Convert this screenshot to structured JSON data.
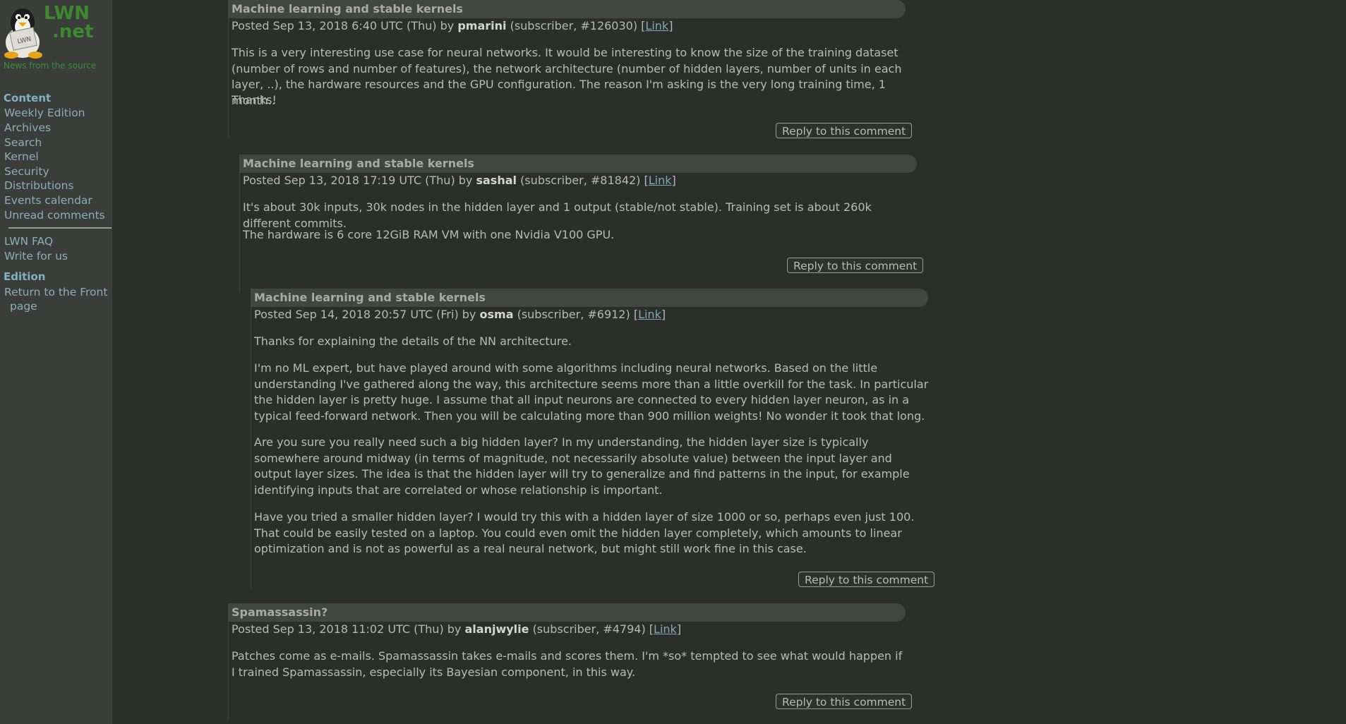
{
  "site": {
    "logo_line1": "LWN",
    "logo_line2": ".net",
    "tagline": "News from the source",
    "penguin_badge": "LWN"
  },
  "sidebar": {
    "content_heading": "Content",
    "content_items": [
      "Weekly Edition",
      "Archives",
      "Search",
      "Kernel",
      "Security",
      "Distributions",
      "Events calendar",
      "Unread comments"
    ],
    "extra_items": [
      "LWN FAQ",
      "Write for us"
    ],
    "edition_heading": "Edition",
    "edition_item_line1": "Return to the Front",
    "edition_item_line2": "page"
  },
  "comments": [
    {
      "title": "Machine learning and stable kernels",
      "posted_prefix": "Posted Sep 13, 2018 6:40 UTC (Thu) by",
      "author": "pmarini",
      "subscriber": "(subscriber, #126030)",
      "link_label": "Link",
      "paragraphs": [
        "This is a very interesting use case for neural networks. It would be interesting to know the size of the training dataset (number of rows and number of features), the network architecture (number of hidden layers, number of units in each layer, ..), the hardware resources and the GPU configuration. The reason I'm asking is the very long training time, 1 month..",
        "Thanks!"
      ],
      "reply_label": "Reply to this comment"
    },
    {
      "title": "Machine learning and stable kernels",
      "posted_prefix": "Posted Sep 13, 2018 17:19 UTC (Thu) by",
      "author": "sashal",
      "subscriber": "(subscriber, #81842)",
      "link_label": "Link",
      "paragraphs": [
        "It's about 30k inputs, 30k nodes in the hidden layer and 1 output (stable/not stable). Training set is about 260k different commits.",
        "The hardware is 6 core 12GiB RAM VM with one Nvidia V100 GPU."
      ],
      "reply_label": "Reply to this comment"
    },
    {
      "title": "Machine learning and stable kernels",
      "posted_prefix": "Posted Sep 14, 2018 20:57 UTC (Fri) by",
      "author": "osma",
      "subscriber": "(subscriber, #6912)",
      "link_label": "Link",
      "paragraphs": [
        "Thanks for explaining the details of the NN architecture.",
        "I'm no ML expert, but have played around with some algorithms including neural networks. Based on the little understanding I've gathered along the way, this architecture seems more than a little overkill for the task. In particular the hidden layer is pretty huge. I assume that all input neurons are connected to every hidden layer neuron, as in a typical feed-forward network. Then you will be calculating more than 900 million weights! No wonder it took that long.",
        "Are you sure you really need such a big hidden layer? In my understanding, the hidden layer size is typically somewhere around midway (in terms of magnitude, not necessarily absolute value) between the input layer and output layer sizes. The idea is that the hidden layer will try to generalize and find patterns in the input, for example identifying inputs that are correlated or whose relationship is important.",
        "Have you tried a smaller hidden layer? I would try this with a hidden layer of size 1000 or so, perhaps even just 100. That could be easily tested on a laptop. You could even omit the hidden layer completely, which amounts to linear optimization and is not as powerful as a real neural network, but might still work fine in this case."
      ],
      "reply_label": "Reply to this comment"
    },
    {
      "title": "Spamassassin?",
      "posted_prefix": "Posted Sep 13, 2018 11:02 UTC (Thu) by",
      "author": "alanjwylie",
      "subscriber": "(subscriber, #4794)",
      "link_label": "Link",
      "paragraphs": [
        "Patches come as e-mails. Spamassassin takes e-mails and scores them. I'm *so* tempted to see what would happen if I trained Spamassassin, especially its Bayesian component, in this way."
      ],
      "reply_label": "Reply to this comment"
    }
  ]
}
